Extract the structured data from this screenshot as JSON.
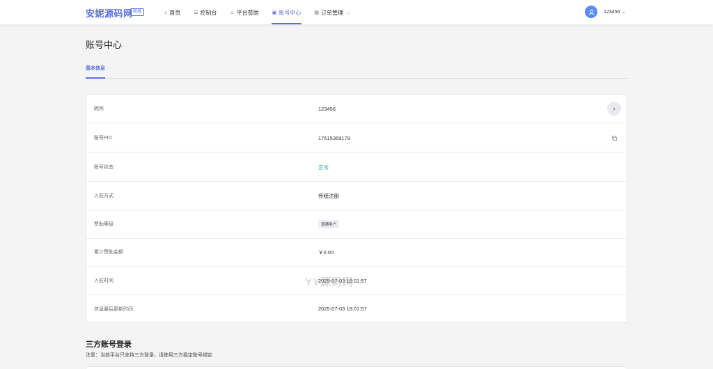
{
  "header": {
    "logo": "安妮源码网",
    "logo_badge": "商城",
    "nav": [
      {
        "icon": "home-icon",
        "glyph": "⌂",
        "label": "首页"
      },
      {
        "icon": "dashboard-icon",
        "glyph": "☷",
        "label": "控制台"
      },
      {
        "icon": "hand-heart-icon",
        "glyph": "♨",
        "label": "平台赞助"
      },
      {
        "icon": "account-icon",
        "glyph": "▣",
        "label": "账号中心"
      },
      {
        "icon": "order-icon",
        "glyph": "▤",
        "label": "订单管理"
      }
    ],
    "active_nav": "账号中心",
    "username": "123456"
  },
  "page": {
    "title": "账号中心",
    "tab": "基本信息"
  },
  "info": {
    "nickname_label": "昵称",
    "nickname_value": "123456",
    "pid_label": "账号PID",
    "pid_value": "17515369179",
    "status_label": "账号状态",
    "status_value": "正常",
    "join_method_label": "入驻方式",
    "join_method_value": "传统注册",
    "sponsor_level_label": "赞助等级",
    "sponsor_level_value": "普通用户",
    "sponsor_total_label": "累计赞助金额",
    "sponsor_total_value": "￥0.00",
    "join_time_label": "入驻时间",
    "join_time_value": "2025-07-03 18:01:57",
    "updated_label": "信息最后更新时间",
    "updated_value": "2025-07-03 18:01:57"
  },
  "watermark": "YY源码网",
  "third_party": {
    "title": "三方账号登录",
    "note": "注意：当前平台只支持三方登录，请使用三方稳定账号绑定"
  },
  "colors": {
    "accent": "#5b6fe0",
    "status_ok": "#2bb39a",
    "background": "#f4f4f5"
  }
}
